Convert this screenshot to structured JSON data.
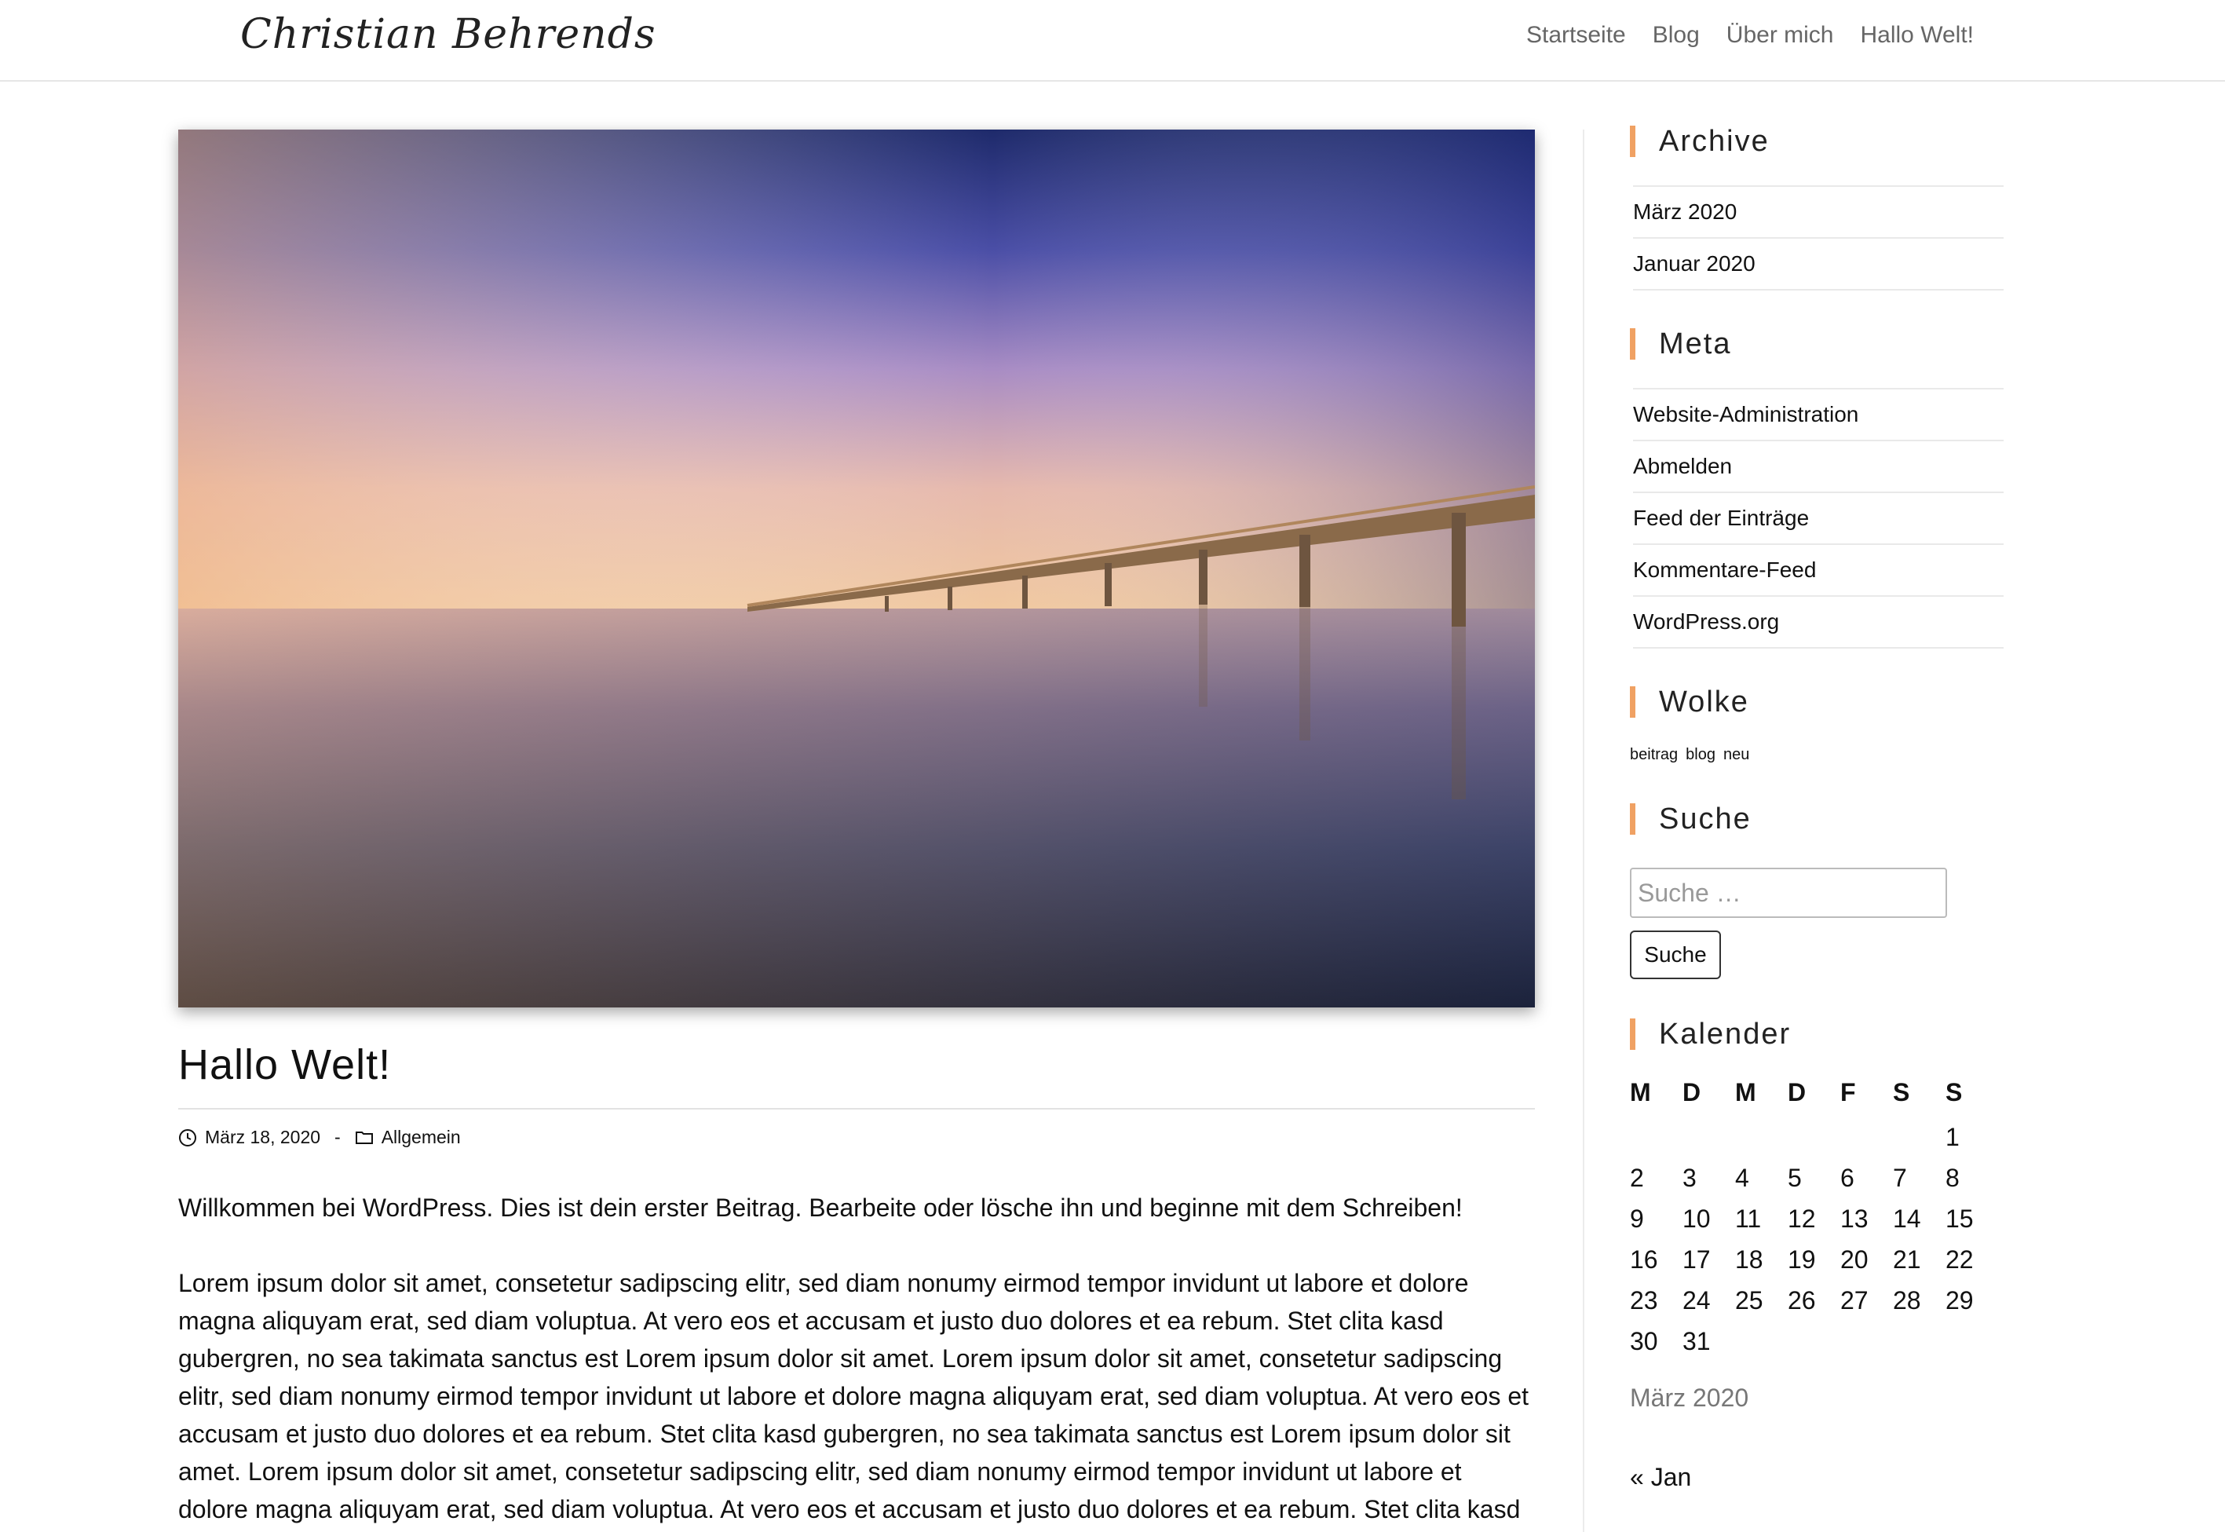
{
  "header": {
    "logo": "Christian Behrends",
    "nav": [
      "Startseite",
      "Blog",
      "Über mich",
      "Hallo Welt!"
    ]
  },
  "post": {
    "title": "Hallo Welt!",
    "date": "März 18, 2020",
    "separator": "-",
    "category": "Allgemein",
    "paragraphs": [
      "Willkommen bei WordPress. Dies ist dein erster Beitrag. Bearbeite oder lösche ihn und beginne mit dem Schreiben!",
      "Lorem ipsum dolor sit amet, consetetur sadipscing elitr, sed diam nonumy eirmod tempor invidunt ut labore et dolore magna aliquyam erat, sed diam voluptua. At vero eos et accusam et justo duo dolores et ea rebum. Stet clita kasd gubergren, no sea takimata sanctus est Lorem ipsum dolor sit amet. Lorem ipsum dolor sit amet, consetetur sadipscing elitr, sed diam nonumy eirmod tempor invidunt ut labore et dolore magna aliquyam erat, sed diam voluptua. At vero eos et accusam et justo duo dolores et ea rebum. Stet clita kasd gubergren, no sea takimata sanctus est Lorem ipsum dolor sit amet. Lorem ipsum dolor sit amet, consetetur sadipscing elitr, sed diam nonumy eirmod tempor invidunt ut labore et dolore magna aliquyam erat, sed diam voluptua. At vero eos et accusam et justo duo dolores et ea rebum. Stet clita kasd"
    ]
  },
  "sidebar": {
    "archive": {
      "title": "Archive",
      "items": [
        "März 2020",
        "Januar 2020"
      ]
    },
    "meta": {
      "title": "Meta",
      "items": [
        "Website-Administration",
        "Abmelden",
        "Feed der Einträge",
        "Kommentare-Feed",
        "WordPress.org"
      ]
    },
    "cloud": {
      "title": "Wolke",
      "tags": [
        "beitrag",
        "blog",
        "neu"
      ]
    },
    "search": {
      "title": "Suche",
      "placeholder": "Suche …",
      "button": "Suche"
    },
    "calendar": {
      "title": "Kalender",
      "days": [
        "M",
        "D",
        "M",
        "D",
        "F",
        "S",
        "S"
      ],
      "weeks": [
        [
          "",
          "",
          "",
          "",
          "",
          "",
          "1"
        ],
        [
          "2",
          "3",
          "4",
          "5",
          "6",
          "7",
          "8"
        ],
        [
          "9",
          "10",
          "11",
          "12",
          "13",
          "14",
          "15"
        ],
        [
          "16",
          "17",
          "18",
          "19",
          "20",
          "21",
          "22"
        ],
        [
          "23",
          "24",
          "25",
          "26",
          "27",
          "28",
          "29"
        ],
        [
          "30",
          "31",
          "",
          "",
          "",
          "",
          ""
        ]
      ],
      "caption": "März 2020",
      "prev": "« Jan"
    }
  },
  "colors": {
    "accent": "#f0a163",
    "nav_text": "#666666"
  }
}
